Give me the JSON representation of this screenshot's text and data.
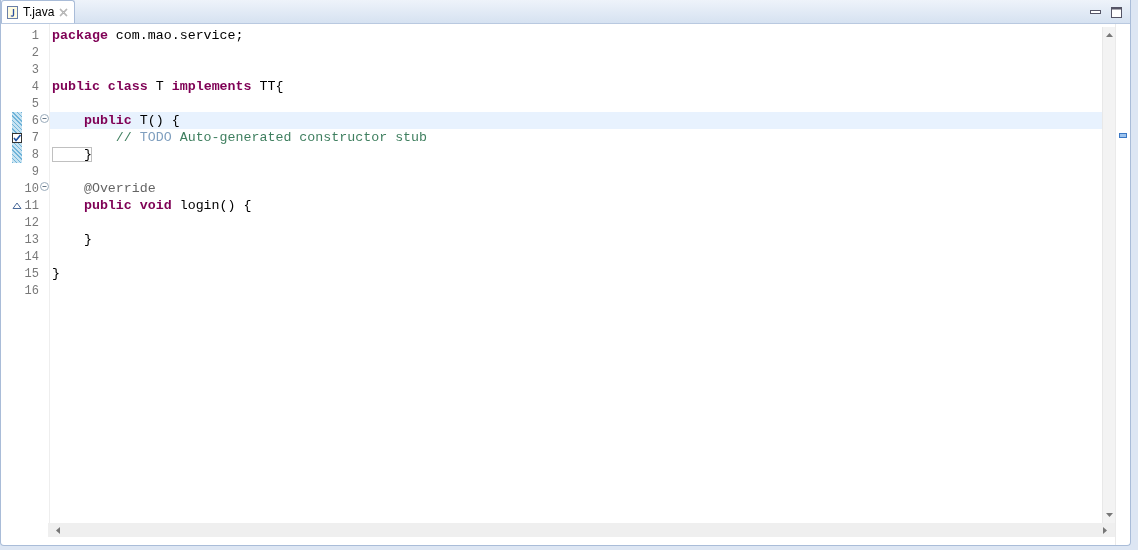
{
  "tabs": [
    {
      "label": "T.java",
      "selected": true
    }
  ],
  "lines": [
    {
      "number": "1",
      "current": false,
      "change": false,
      "fold": false,
      "task": false,
      "override": false,
      "tokens": [
        {
          "kind": "keyword",
          "text": "package"
        },
        {
          "kind": "plain",
          "text": " com.mao.service;"
        }
      ]
    },
    {
      "number": "2",
      "current": false,
      "change": false,
      "fold": false,
      "task": false,
      "override": false
    },
    {
      "number": "3",
      "current": false,
      "change": false,
      "fold": false,
      "task": false,
      "override": false
    },
    {
      "number": "4",
      "current": false,
      "change": false,
      "fold": false,
      "task": false,
      "override": false,
      "tokens": [
        {
          "kind": "keyword",
          "text": "public"
        },
        {
          "kind": "keyword",
          "text": " class"
        },
        {
          "kind": "plain",
          "text": " T"
        },
        {
          "kind": "keyword",
          "text": " implements"
        },
        {
          "kind": "plain",
          "text": " TT{"
        }
      ]
    },
    {
      "number": "5",
      "current": false,
      "change": false,
      "fold": false,
      "task": false,
      "override": false
    },
    {
      "number": "6",
      "current": true,
      "change": true,
      "fold": true,
      "task": false,
      "override": false,
      "tokens": [
        {
          "kind": "keyword",
          "text": "    public"
        },
        {
          "kind": "plain",
          "text": " T() {"
        }
      ]
    },
    {
      "number": "7",
      "current": false,
      "change": true,
      "fold": false,
      "task": true,
      "override": false,
      "tokens": [
        {
          "kind": "comment",
          "text": "        //"
        },
        {
          "kind": "todo",
          "text": " TODO"
        },
        {
          "kind": "comment",
          "text": " Auto-generated constructor stub"
        }
      ]
    },
    {
      "number": "8",
      "current": false,
      "change": true,
      "fold": false,
      "task": false,
      "override": false,
      "tokens": [
        {
          "kind": "bracket",
          "text": "    }"
        }
      ]
    },
    {
      "number": "9",
      "current": false,
      "change": false,
      "fold": false,
      "task": false,
      "override": false
    },
    {
      "number": "10",
      "current": false,
      "change": false,
      "fold": true,
      "task": false,
      "override": false,
      "tokens": [
        {
          "kind": "annotation",
          "text": "    @Override"
        }
      ]
    },
    {
      "number": "11",
      "current": false,
      "change": false,
      "fold": false,
      "task": false,
      "override": true,
      "tokens": [
        {
          "kind": "keyword",
          "text": "    public"
        },
        {
          "kind": "keyword",
          "text": " void"
        },
        {
          "kind": "plain",
          "text": " login() {"
        }
      ]
    },
    {
      "number": "12",
      "current": false,
      "change": false,
      "fold": false,
      "task": false,
      "override": false
    },
    {
      "number": "13",
      "current": false,
      "change": false,
      "fold": false,
      "task": false,
      "override": false,
      "tokens": [
        {
          "kind": "plain",
          "text": "    }"
        }
      ]
    },
    {
      "number": "14",
      "current": false,
      "change": false,
      "fold": false,
      "task": false,
      "override": false
    },
    {
      "number": "15",
      "current": false,
      "change": false,
      "fold": false,
      "task": false,
      "override": false,
      "tokens": [
        {
          "kind": "plain",
          "text": "}"
        }
      ]
    },
    {
      "number": "16",
      "current": false,
      "change": false,
      "fold": false,
      "task": false,
      "override": false
    }
  ]
}
